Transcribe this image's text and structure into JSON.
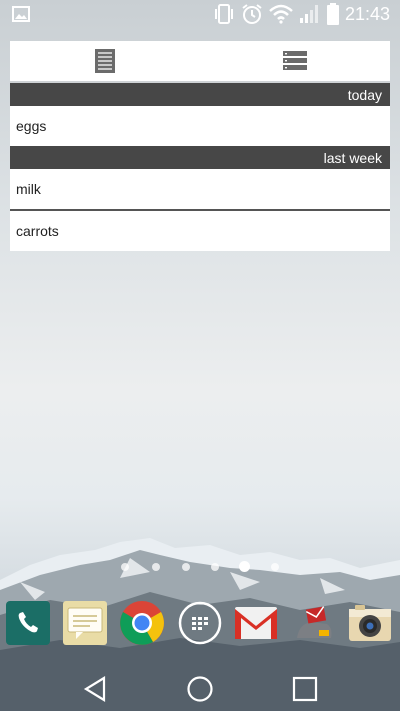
{
  "status_bar": {
    "time": "21:43",
    "icons": [
      "image-notification-icon",
      "vibrate-icon",
      "alarm-icon",
      "wifi-icon",
      "signal-icon",
      "battery-icon"
    ]
  },
  "widget": {
    "tabs": [
      {
        "name": "list-view-icon"
      },
      {
        "name": "grouped-view-icon"
      }
    ],
    "sections": [
      {
        "header": "today",
        "items": [
          "eggs"
        ]
      },
      {
        "header": "last week",
        "items": [
          "milk",
          "carrots"
        ]
      }
    ]
  },
  "home_pages": {
    "count": 6,
    "active_index": 4
  },
  "dock": {
    "apps": [
      "phone-icon",
      "messages-icon",
      "chrome-icon",
      "apps-drawer-icon",
      "gmail-icon",
      "mail-app-icon",
      "camera-icon"
    ]
  },
  "nav": {
    "buttons": [
      "back-button",
      "home-button",
      "recents-button"
    ]
  }
}
